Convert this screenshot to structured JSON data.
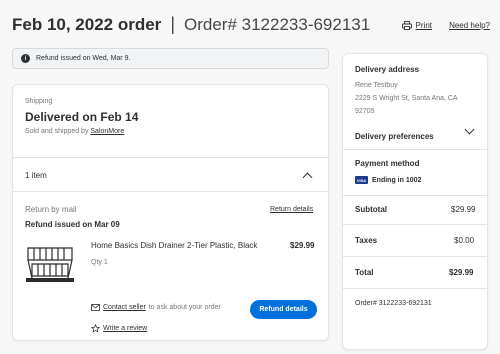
{
  "header": {
    "title": "Feb 10, 2022 order",
    "separator": "|",
    "order_number": "Order# 3122233-692131",
    "print_label": "Print",
    "help_label": "Need help?"
  },
  "notice": {
    "text": "Refund issued on Wed, Mar 9."
  },
  "shipping": {
    "label": "Shipping",
    "status": "Delivered on Feb 14",
    "sold_by_prefix": "Sold and shipped by",
    "seller": "SalonMore"
  },
  "items": {
    "count_label": "1 item",
    "return_method": "Return by mail",
    "return_details_link": "Return details",
    "refund_status": "Refund issued on Mar 09",
    "product": {
      "name": "Home Basics Dish Drainer 2-Tier Plastic, Black",
      "price": "$29.99",
      "qty": "Qty 1"
    },
    "contact_seller_link": "Contact seller",
    "contact_suffix": "to ask about your order",
    "write_review_link": "Write a review",
    "refund_button": "Refund details"
  },
  "sidebar": {
    "delivery_address_title": "Delivery address",
    "name": "Rene Testbuy",
    "street": "2229 S Wright St, Santa Ana, CA",
    "zip": "92705",
    "delivery_preferences": "Delivery preferences",
    "payment_title": "Payment method",
    "card_brand": "VISA",
    "card_ending": "Ending in 1002",
    "subtotal_label": "Subtotal",
    "subtotal_value": "$29.99",
    "taxes_label": "Taxes",
    "taxes_value": "$0.00",
    "total_label": "Total",
    "total_value": "$29.99",
    "footer_order": "Order# 3122233-692131"
  },
  "colors": {
    "accent": "#0071dc",
    "text": "#2e2f32",
    "muted": "#74767c",
    "card_brand": "#1a3d8f"
  }
}
